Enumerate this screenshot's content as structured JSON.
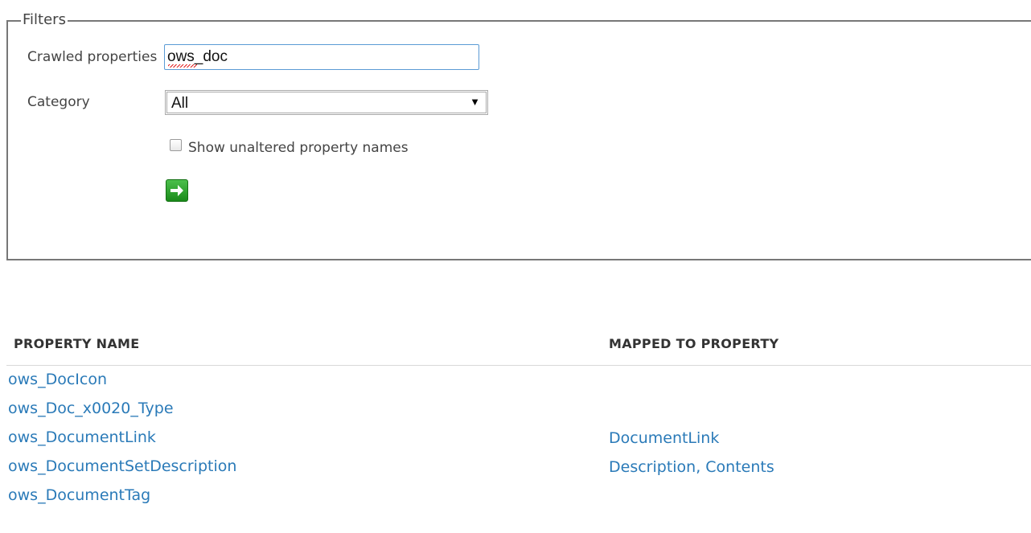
{
  "filters": {
    "legend": "Filters",
    "crawled_label": "Crawled properties",
    "crawled_value": "ows_doc",
    "category_label": "Category",
    "category_selected": "All",
    "show_unaltered_label": "Show unaltered property names",
    "show_unaltered_checked": false,
    "go_icon": "green-arrow-right-icon",
    "go_color": "#2aa22a"
  },
  "table": {
    "headers": {
      "name": "PROPERTY NAME",
      "mapped": "MAPPED TO PROPERTY"
    },
    "rows": [
      {
        "name": "ows_DocIcon",
        "mapped": ""
      },
      {
        "name": "ows_Doc_x0020_Type",
        "mapped": ""
      },
      {
        "name": "ows_DocumentLink",
        "mapped": "DocumentLink"
      },
      {
        "name": "ows_DocumentSetDescription",
        "mapped": "Description, Contents"
      },
      {
        "name": "ows_DocumentTag",
        "mapped": ""
      }
    ]
  },
  "colors": {
    "link": "#2a7ab8",
    "input_focus_border": "#5b9bd5"
  }
}
